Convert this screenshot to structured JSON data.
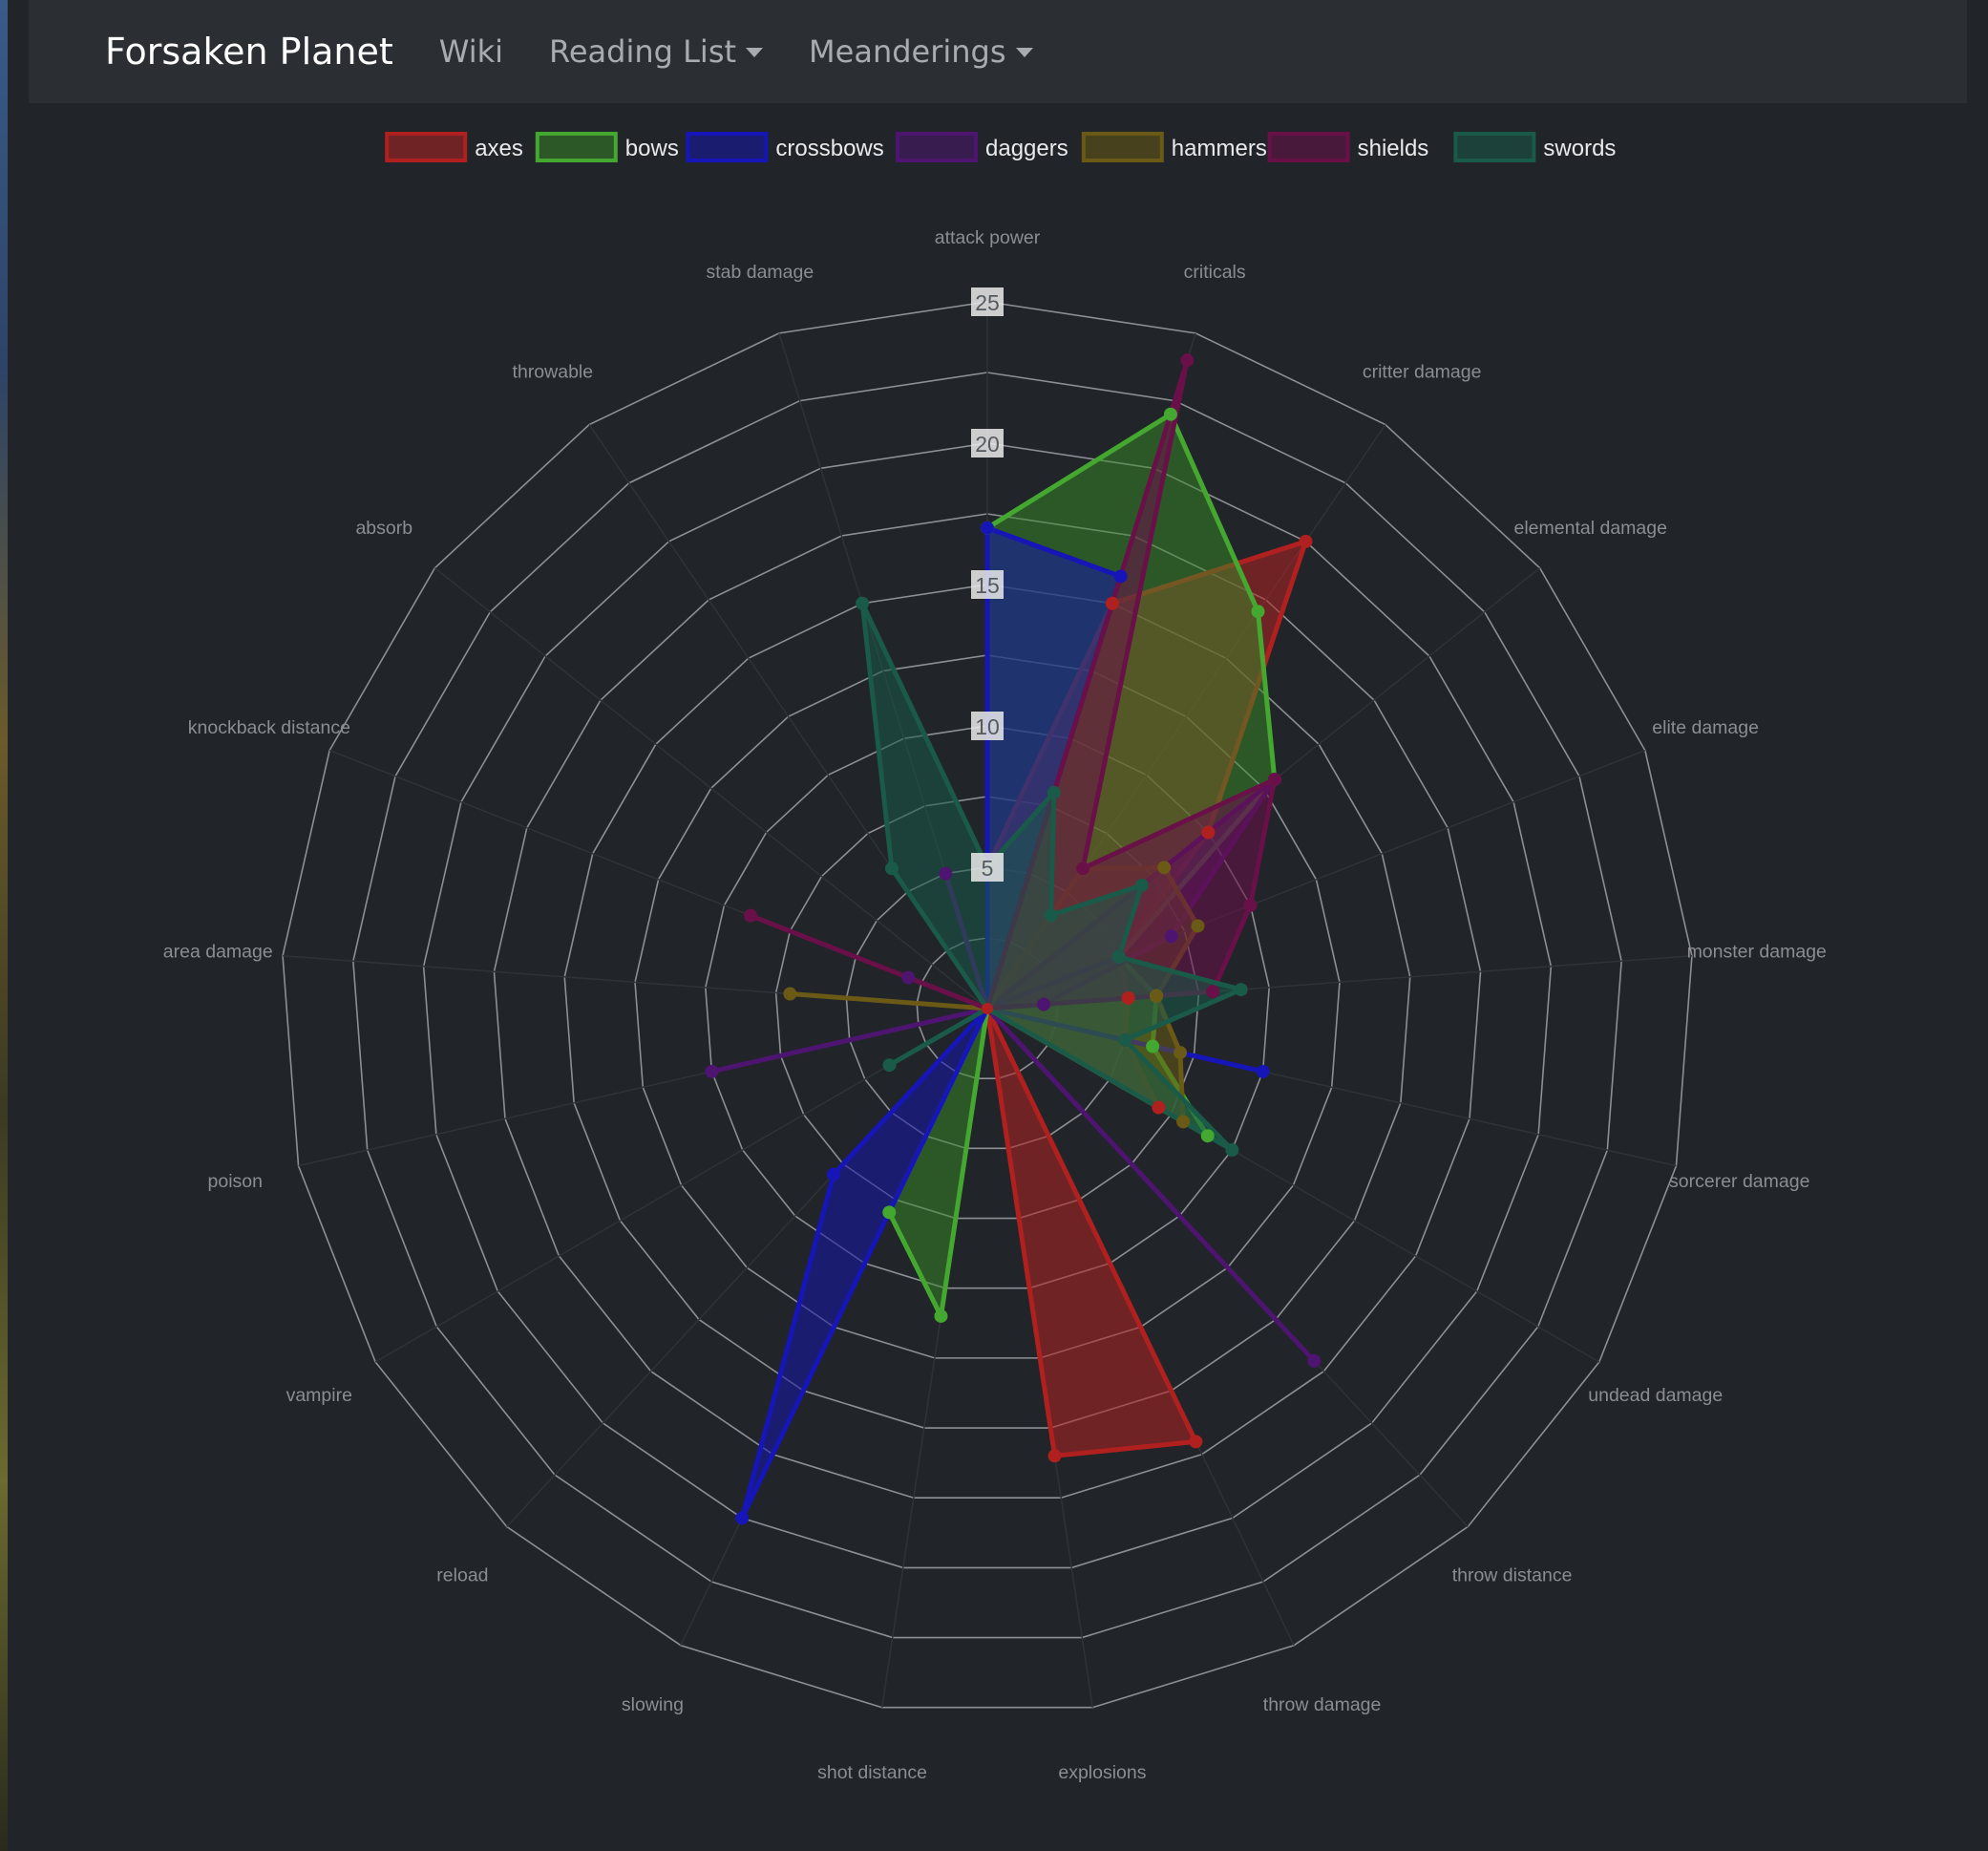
{
  "navbar": {
    "brand": "Forsaken Planet",
    "links": [
      {
        "label": "Wiki",
        "dropdown": false
      },
      {
        "label": "Reading List",
        "dropdown": true
      },
      {
        "label": "Meanderings",
        "dropdown": true
      }
    ]
  },
  "colors": {
    "background": "#212428",
    "navbar": "#2b2f34",
    "grid": "#8c8f94",
    "label": "#8a8e93"
  },
  "chart_data": {
    "type": "radar",
    "legend_position": "top-center",
    "radial_ticks": [
      "5",
      "10",
      "15",
      "20",
      "25"
    ],
    "radial_range": [
      0,
      25
    ],
    "axes": [
      "attack power",
      "criticals",
      "critter damage",
      "elemental damage",
      "elite damage",
      "monster damage",
      "sorcerer damage",
      "undead damage",
      "throw distance",
      "throw damage",
      "explosions",
      "shot distance",
      "slowing",
      "reload",
      "vampire",
      "poison",
      "area damage",
      "knockback distance",
      "absorb",
      "throwable",
      "stab damage"
    ],
    "series": [
      {
        "name": "axes",
        "color": "#b0201e",
        "fill": "rgba(178,34,34,0.55)",
        "values": [
          5,
          15,
          20,
          10,
          5,
          5,
          5,
          7,
          0,
          17,
          16,
          0,
          0,
          0,
          0,
          0,
          0,
          0,
          0,
          0,
          0
        ]
      },
      {
        "name": "bows",
        "color": "#44a830",
        "fill": "rgba(56,140,40,0.50)",
        "values": [
          17,
          22,
          17,
          13,
          5,
          6,
          6,
          9,
          0,
          0,
          0,
          11,
          8,
          0,
          0,
          0,
          0,
          0,
          0,
          0,
          0
        ]
      },
      {
        "name": "crossbows",
        "color": "#1616b8",
        "fill": "rgba(22,22,170,0.55)",
        "values": [
          17,
          16,
          0,
          0,
          5,
          0,
          10,
          0,
          0,
          0,
          0,
          0,
          20,
          8,
          0,
          0,
          0,
          0,
          0,
          0,
          0
        ]
      },
      {
        "name": "daggers",
        "color": "#4d1570",
        "fill": "rgba(77,21,112,0.55)",
        "values": [
          0,
          0,
          0,
          13,
          7,
          2,
          0,
          0,
          17,
          0,
          0,
          0,
          0,
          0,
          0,
          10,
          0,
          3,
          0,
          0,
          5
        ]
      },
      {
        "name": "hammers",
        "color": "#6a5a16",
        "fill": "rgba(106,90,22,0.55)",
        "values": [
          0,
          0,
          6,
          8,
          8,
          6,
          7,
          8,
          0,
          0,
          0,
          0,
          0,
          0,
          0,
          0,
          7,
          0,
          0,
          0,
          0
        ]
      },
      {
        "name": "shields",
        "color": "#6a1048",
        "fill": "rgba(106,16,72,0.55)",
        "values": [
          0,
          24,
          6,
          13,
          10,
          8,
          0,
          0,
          0,
          0,
          0,
          0,
          0,
          0,
          0,
          0,
          0,
          9,
          0,
          0,
          0
        ]
      },
      {
        "name": "swords",
        "color": "#1a5a48",
        "fill": "rgba(26,90,72,0.55)",
        "values": [
          5,
          8,
          4,
          7,
          5,
          9,
          5,
          10,
          0,
          0,
          0,
          0,
          0,
          0,
          4,
          0,
          0,
          0,
          0,
          6,
          15
        ]
      }
    ]
  }
}
